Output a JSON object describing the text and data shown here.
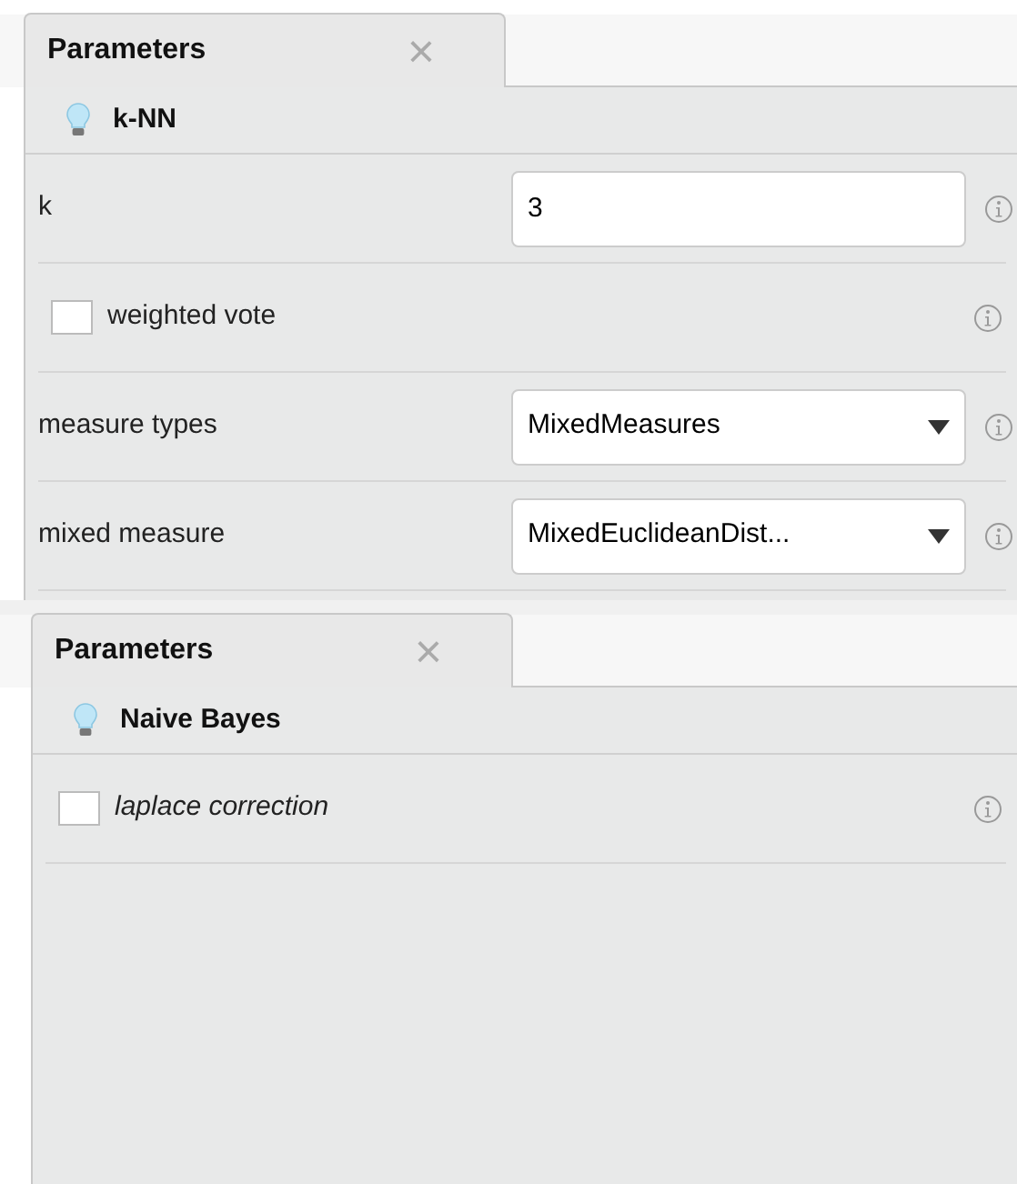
{
  "panels": [
    {
      "tab": {
        "label": "Parameters",
        "close": "×"
      },
      "operator": "k-NN",
      "parameters": [
        {
          "kind": "number",
          "label": "k",
          "value": "3",
          "expert": false
        },
        {
          "kind": "checkbox",
          "label": "weighted vote",
          "checked": false,
          "expert": false
        },
        {
          "kind": "select",
          "label": "measure types",
          "value": "MixedMeasures",
          "expert": false
        },
        {
          "kind": "select",
          "label": "mixed measure",
          "value": "MixedEuclideanDist...",
          "expert": false
        }
      ]
    },
    {
      "tab": {
        "label": "Parameters",
        "close": "×"
      },
      "operator": "Naive Bayes",
      "parameters": [
        {
          "kind": "checkbox",
          "label": "laplace correction",
          "checked": false,
          "expert": true
        }
      ]
    }
  ]
}
